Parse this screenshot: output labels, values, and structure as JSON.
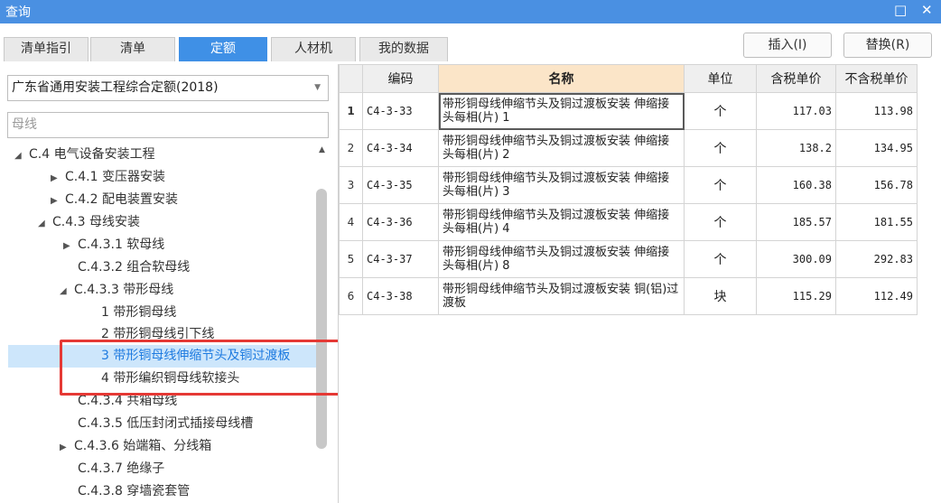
{
  "window": {
    "title": "查询",
    "minimize_icon": "restore-icon",
    "close_icon": "close-icon"
  },
  "tabs": [
    {
      "label": "清单指引"
    },
    {
      "label": "清单"
    },
    {
      "label": "定额",
      "active": true
    },
    {
      "label": "人材机"
    },
    {
      "label": "我的数据"
    }
  ],
  "actions": {
    "insert_label": "插入(I)",
    "replace_label": "替换(R)"
  },
  "left": {
    "quota_library": "广东省通用安装工程综合定额(2018)",
    "search_value": "母线",
    "tree": [
      {
        "label": "C.4 电气设备安装工程",
        "toggle": "◢"
      },
      {
        "label": "C.4.1 变压器安装",
        "toggle": "▶"
      },
      {
        "label": "C.4.2 配电装置安装",
        "toggle": "▶"
      },
      {
        "label": "C.4.3 母线安装",
        "toggle": "◢"
      },
      {
        "label": "C.4.3.1 软母线",
        "toggle": "▶"
      },
      {
        "label": "C.4.3.2 组合软母线",
        "toggle": ""
      },
      {
        "label": "C.4.3.3 带形母线",
        "toggle": "◢"
      },
      {
        "label": "1 带形铜母线",
        "toggle": ""
      },
      {
        "label": "2 带形铜母线引下线",
        "toggle": ""
      },
      {
        "label": "3 带形铜母线伸缩节头及铜过渡板",
        "toggle": "",
        "selected": true
      },
      {
        "label": "4 带形编织铜母线软接头",
        "toggle": ""
      },
      {
        "label": "C.4.3.4 共箱母线",
        "toggle": ""
      },
      {
        "label": "C.4.3.5 低压封闭式插接母线槽",
        "toggle": ""
      },
      {
        "label": "C.4.3.6 始端箱、分线箱",
        "toggle": "▶"
      },
      {
        "label": "C.4.3.7 绝缘子",
        "toggle": ""
      },
      {
        "label": "C.4.3.8 穿墙瓷套管",
        "toggle": ""
      }
    ]
  },
  "table": {
    "headers": {
      "code": "编码",
      "name": "名称",
      "unit": "单位",
      "price_tax": "含税单价",
      "price_notax": "不含税单价"
    },
    "rows": [
      {
        "no": "1",
        "code": "C4-3-33",
        "name": "带形铜母线伸缩节头及铜过渡板安装 伸缩接头每相(片) 1",
        "unit": "个",
        "price_tax": "117.03",
        "price_notax": "113.98"
      },
      {
        "no": "2",
        "code": "C4-3-34",
        "name": "带形铜母线伸缩节头及铜过渡板安装 伸缩接头每相(片) 2",
        "unit": "个",
        "price_tax": "138.2",
        "price_notax": "134.95"
      },
      {
        "no": "3",
        "code": "C4-3-35",
        "name": "带形铜母线伸缩节头及铜过渡板安装 伸缩接头每相(片) 3",
        "unit": "个",
        "price_tax": "160.38",
        "price_notax": "156.78"
      },
      {
        "no": "4",
        "code": "C4-3-36",
        "name": "带形铜母线伸缩节头及铜过渡板安装 伸缩接头每相(片) 4",
        "unit": "个",
        "price_tax": "185.57",
        "price_notax": "181.55"
      },
      {
        "no": "5",
        "code": "C4-3-37",
        "name": "带形铜母线伸缩节头及铜过渡板安装 伸缩接头每相(片) 8",
        "unit": "个",
        "price_tax": "300.09",
        "price_notax": "292.83"
      },
      {
        "no": "6",
        "code": "C4-3-38",
        "name": "带形铜母线伸缩节头及铜过渡板安装 铜(铝)过渡板",
        "unit": "块",
        "price_tax": "115.29",
        "price_notax": "112.49"
      }
    ]
  },
  "colors": {
    "titlebar": "#4a90e2",
    "active_tab": "#3f90e6",
    "selection": "#cde6fb",
    "highlight_box": "#e53935",
    "name_header": "#fbe5c8"
  }
}
